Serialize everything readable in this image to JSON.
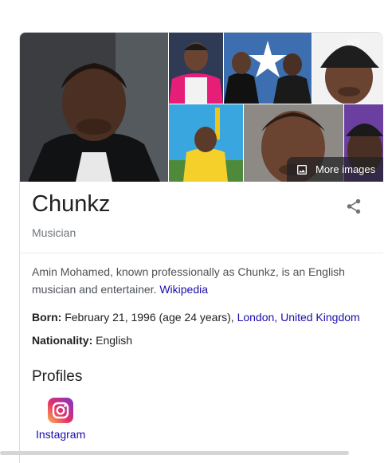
{
  "knowledge_panel": {
    "more_images_label": "More images",
    "title": "Chunkz",
    "subtitle": "Musician",
    "description": {
      "text": "Amin Mohamed, known professionally as Chunkz, is an English musician and entertainer.",
      "source_link": "Wikipedia"
    },
    "facts": {
      "born_label": "Born:",
      "born_value": "February 21, 1996 (age 24 years),",
      "born_place_city": "London,",
      "born_place_country": "United Kingdom",
      "nationality_label": "Nationality:",
      "nationality_value": "English"
    },
    "profiles": {
      "heading": "Profiles",
      "items": [
        {
          "label": "Instagram",
          "icon": "instagram-icon"
        }
      ]
    },
    "icons": {
      "share": "share-icon",
      "more_images": "image-icon"
    },
    "colors": {
      "link": "#1a0dab",
      "title": "#202124",
      "muted": "#70757a"
    }
  }
}
